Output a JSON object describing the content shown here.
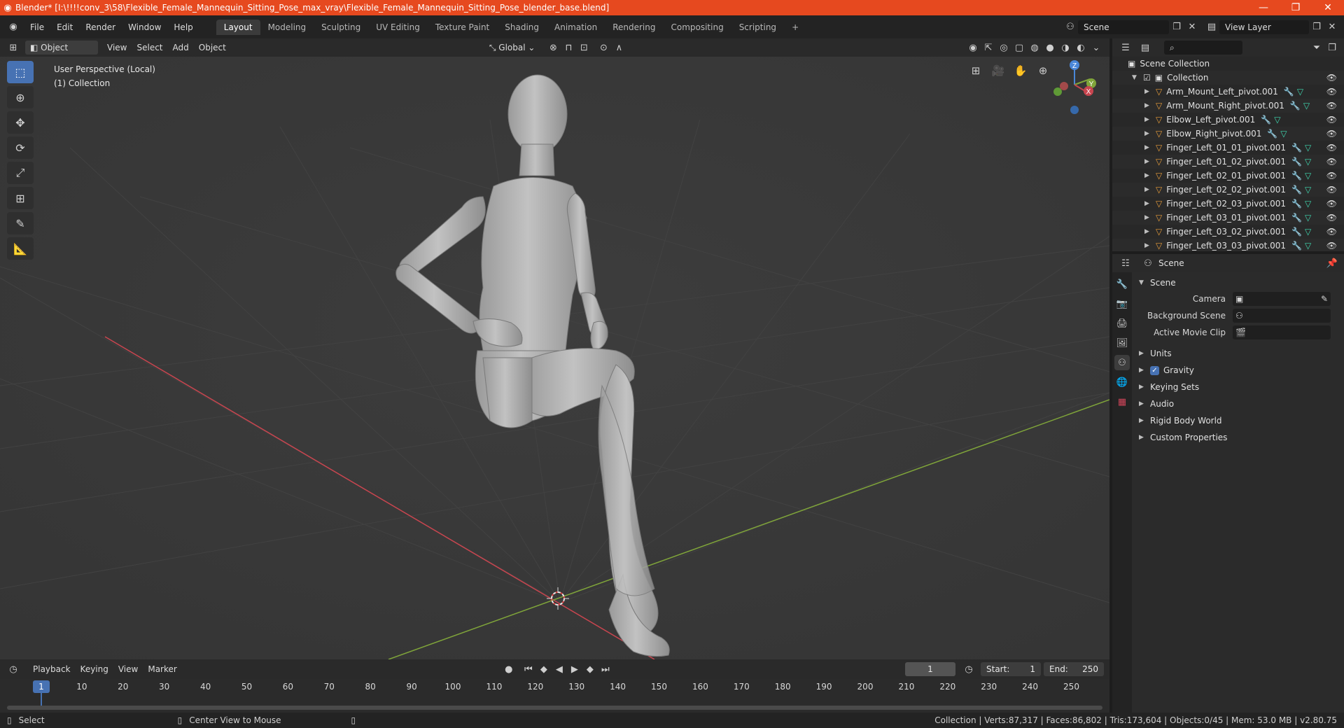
{
  "titlebar": {
    "title": "Blender* [I:\\!!!!conv_3\\58\\Flexible_Female_Mannequin_Sitting_Pose_max_vray\\Flexible_Female_Mannequin_Sitting_Pose_blender_base.blend]",
    "minimize": "—",
    "restore": "❐",
    "close": "✕"
  },
  "menu": [
    "File",
    "Edit",
    "Render",
    "Window",
    "Help"
  ],
  "workspaces": [
    "Layout",
    "Modeling",
    "Sculpting",
    "UV Editing",
    "Texture Paint",
    "Shading",
    "Animation",
    "Rendering",
    "Compositing",
    "Scripting"
  ],
  "active_workspace": "Layout",
  "add_workspace": "+",
  "scene_selector": "Scene",
  "view_layer_selector": "View Layer",
  "viewport_header": {
    "mode": "Object Mode",
    "menus": [
      "View",
      "Select",
      "Add",
      "Object"
    ],
    "transform_orientation": "Global"
  },
  "viewport": {
    "perspective_label": "User Perspective (Local)",
    "collection_label": "(1) Collection",
    "gizmo": {
      "z": "Z",
      "y": "Y",
      "x": "X"
    }
  },
  "outliner": {
    "scene_collection": "Scene Collection",
    "collection": "Collection",
    "items": [
      "Arm_Mount_Left_pivot.001",
      "Arm_Mount_Right_pivot.001",
      "Elbow_Left_pivot.001",
      "Elbow_Right_pivot.001",
      "Finger_Left_01_01_pivot.001",
      "Finger_Left_01_02_pivot.001",
      "Finger_Left_02_01_pivot.001",
      "Finger_Left_02_02_pivot.001",
      "Finger_Left_02_03_pivot.001",
      "Finger_Left_03_01_pivot.001",
      "Finger_Left_03_02_pivot.001",
      "Finger_Left_03_03_pivot.001"
    ]
  },
  "properties": {
    "context": "Scene",
    "panel": "Scene",
    "fields": {
      "camera": "Camera",
      "background_scene": "Background Scene",
      "active_movie_clip": "Active Movie Clip"
    },
    "subpanels": [
      "Units",
      "Gravity",
      "Keying Sets",
      "Audio",
      "Rigid Body World",
      "Custom Properties"
    ]
  },
  "timeline": {
    "menus": [
      "Playback",
      "Keying",
      "View",
      "Marker"
    ],
    "current_frame": "1",
    "start_label": "Start:",
    "start": "1",
    "end_label": "End:",
    "end": "250",
    "ticks": [
      "10",
      "20",
      "30",
      "40",
      "50",
      "60",
      "70",
      "80",
      "90",
      "100",
      "110",
      "120",
      "130",
      "140",
      "150",
      "160",
      "170",
      "180",
      "190",
      "200",
      "210",
      "220",
      "230",
      "240",
      "250"
    ]
  },
  "statusbar": {
    "select": "Select",
    "center_view": "Center View to Mouse",
    "stats": "Collection | Verts:87,317 | Faces:86,802 | Tris:173,604 | Objects:0/45 | Mem: 53.0 MB | v2.80.75"
  },
  "colors": {
    "accent": "#4772b3",
    "title_bar": "#e6491f",
    "x_axis": "#c8454f",
    "y_axis": "#7fa43a",
    "mesh": "#b3b3b3"
  }
}
